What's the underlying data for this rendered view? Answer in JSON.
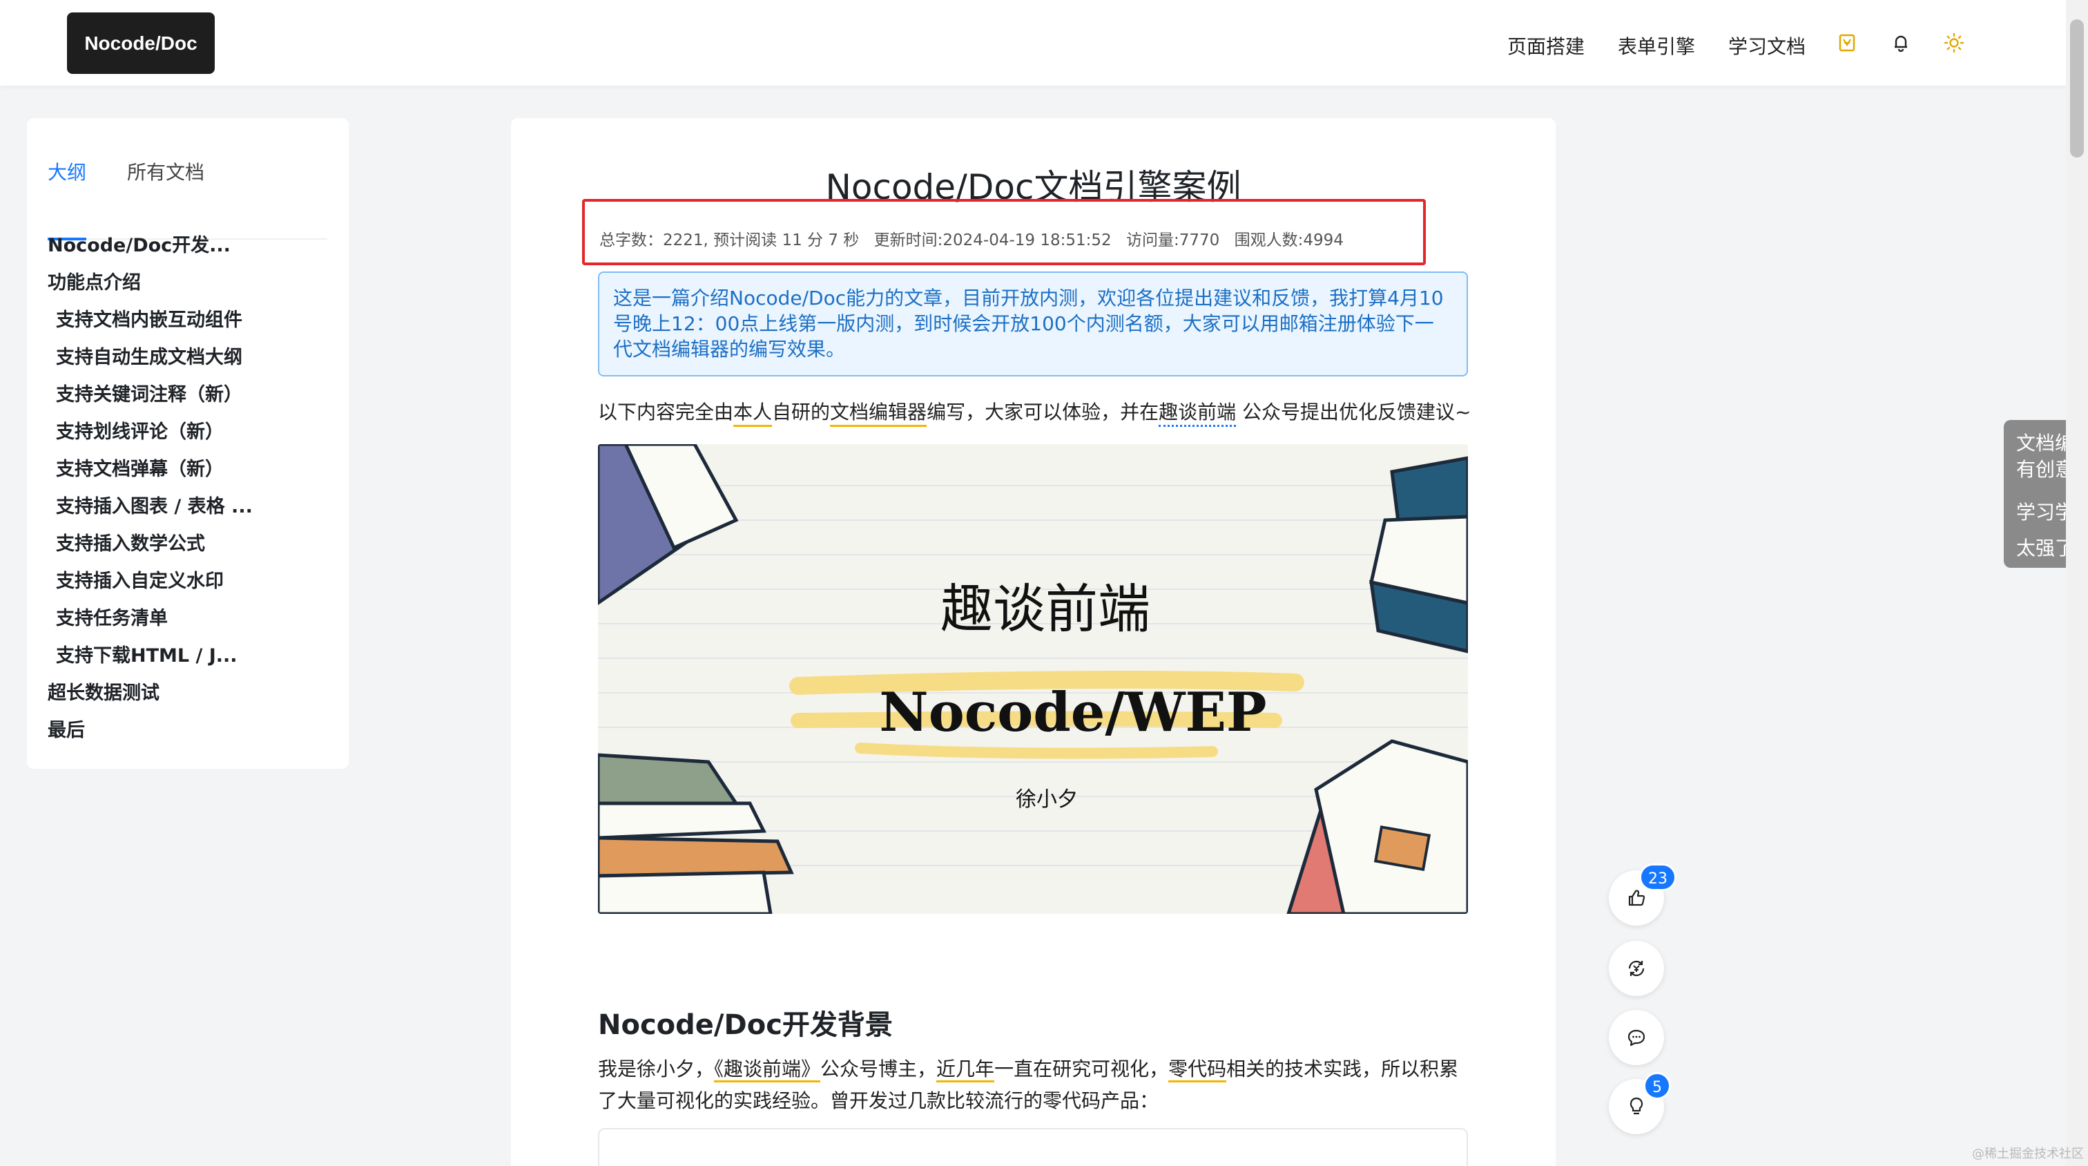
{
  "header": {
    "logo": "Nocode/Doc",
    "nav": [
      "页面搭建",
      "表单引擎",
      "学习文档"
    ],
    "icons": [
      "vip-icon",
      "bell-icon",
      "sun-icon"
    ]
  },
  "sidebar": {
    "tabs": [
      "大纲",
      "所有文档"
    ],
    "toc": [
      {
        "label": "Nocode/Doc开发...",
        "level": 1
      },
      {
        "label": "功能点介绍",
        "level": 1
      },
      {
        "label": "支持文档内嵌互动组件",
        "level": 2
      },
      {
        "label": "支持自动生成文档大纲",
        "level": 2
      },
      {
        "label": "支持关键词注释（新）",
        "level": 2
      },
      {
        "label": "支持划线评论（新）",
        "level": 2
      },
      {
        "label": "支持文档弹幕（新）",
        "level": 2
      },
      {
        "label": "支持插入图表 / 表格 ...",
        "level": 2
      },
      {
        "label": "支持插入数学公式",
        "level": 2
      },
      {
        "label": "支持插入自定义水印",
        "level": 2
      },
      {
        "label": "支持任务清单",
        "level": 2
      },
      {
        "label": "支持下载HTML / J...",
        "level": 2
      },
      {
        "label": "超长数据测试",
        "level": 1
      },
      {
        "label": "最后",
        "level": 1
      }
    ]
  },
  "article": {
    "title": "Nocode/Doc文档引擎案例",
    "meta": {
      "words": "总字数：2221, 预计阅读 11 分 7 秒",
      "updated": "更新时间:2024-04-19 18:51:52",
      "visits": "访问量:7770",
      "watchers": "围观人数:4994"
    },
    "notice": "这是一篇介绍Nocode/Doc能力的文章，目前开放内测，欢迎各位提出建议和反馈，我打算4月10号晚上12：00点上线第一版内测，到时候会开放100个内测名额，大家可以用邮箱注册体验下一代文档编辑器的编写效果。",
    "intro": {
      "p1": "以下内容完全由",
      "u1": "本人",
      "p2": "自研的",
      "u2": "文档编辑器",
      "p3": "编写，大家可以体验，并在",
      "u3": "趣谈前端",
      "p4": " 公众号提出优化反馈建议~"
    },
    "cover": {
      "title": "趣谈前端",
      "subtitle": "Nocode/WEP",
      "author": "徐小夕"
    },
    "section_heading": "Nocode/Doc开发背景",
    "paragraph": {
      "p1": "我是徐小夕，",
      "u1": "《趣谈前端》",
      "p2": "公众号博主，",
      "u2": "近几年",
      "p3": "一直在研究可视化，",
      "u3": "零代码",
      "p4": "相关的技术实践，所以积累了大量可视化的实践经验。曾开发过几款比较流行的零代码产品："
    }
  },
  "fabs": {
    "like_count": "23",
    "idea_count": "5",
    "icons": [
      "thumbs-up-icon",
      "reward-icon",
      "comment-icon",
      "lightbulb-icon"
    ]
  },
  "danmaku": [
    "文档编",
    "有创意",
    "学习学",
    "太强了"
  ],
  "watermark": "@稀土掘金技术社区",
  "colors": {
    "accent": "#1677ff",
    "highlight_border": "#e3262b",
    "notice_bg": "#eaf5ff",
    "underline": "#f5b400"
  }
}
